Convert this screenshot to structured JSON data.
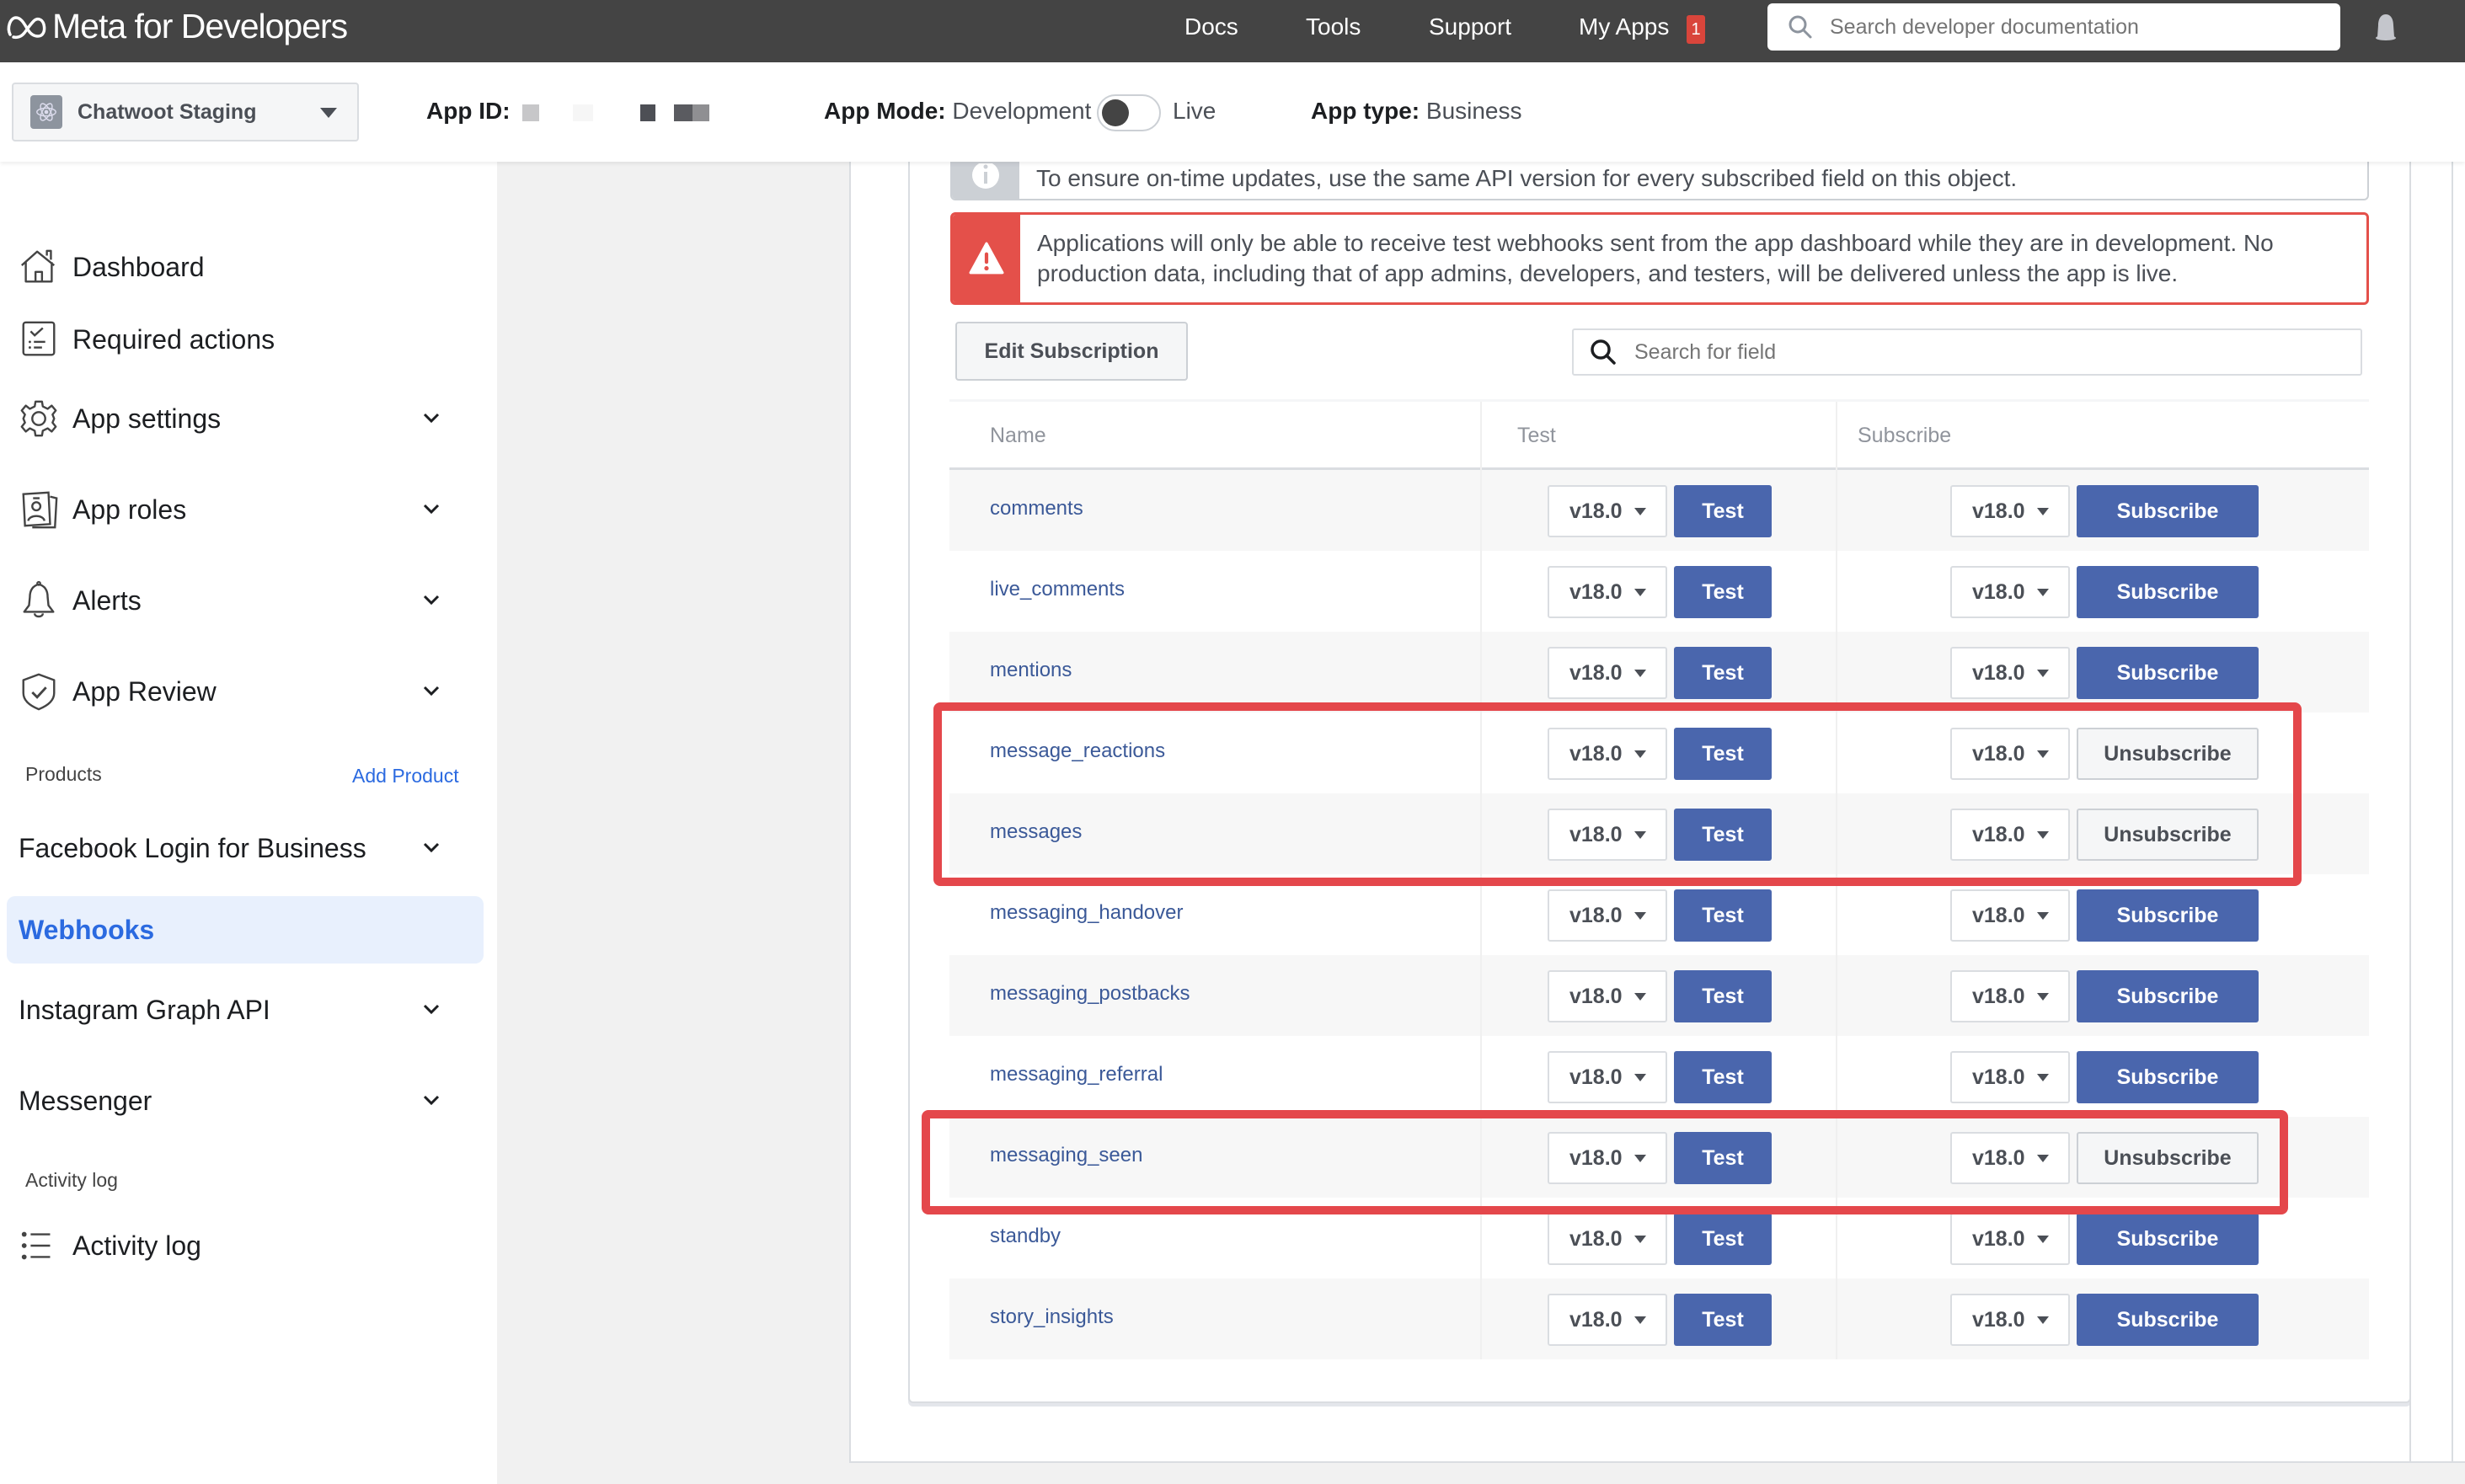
{
  "header": {
    "logo_text": "Meta for Developers",
    "nav": [
      "Docs",
      "Tools",
      "Support",
      "My Apps"
    ],
    "my_apps_badge": "1",
    "search_placeholder": "Search developer documentation"
  },
  "subheader": {
    "app_name": "Chatwoot Staging",
    "app_id_label": "App ID:",
    "app_mode_label": "App Mode:",
    "app_mode_value": "Development",
    "live_label": "Live",
    "app_type_label": "App type:",
    "app_type_value": "Business",
    "live_enabled": false
  },
  "sidebar": {
    "items": [
      {
        "label": "Dashboard",
        "icon": "home-icon"
      },
      {
        "label": "Required actions",
        "icon": "checklist-icon"
      },
      {
        "label": "App settings",
        "icon": "gear-icon",
        "expandable": true
      },
      {
        "label": "App roles",
        "icon": "id-badge-icon",
        "expandable": true
      },
      {
        "label": "Alerts",
        "icon": "bell-icon",
        "expandable": true
      },
      {
        "label": "App Review",
        "icon": "shield-check-icon",
        "expandable": true
      }
    ],
    "products_label": "Products",
    "add_product_label": "Add Product",
    "products": [
      {
        "label": "Facebook Login for Business",
        "expandable": true
      },
      {
        "label": "Webhooks",
        "active": true
      },
      {
        "label": "Instagram Graph API",
        "expandable": true
      },
      {
        "label": "Messenger",
        "expandable": true
      }
    ],
    "activity_section_label": "Activity log",
    "activity_item_label": "Activity log"
  },
  "notices": {
    "info": "To ensure on-time updates, use the same API version for every subscribed field on this object.",
    "warning": "Applications will only be able to receive test webhooks sent from the app dashboard while they are in development. No production data, including that of app admins, developers, and testers, will be delivered unless the app is live."
  },
  "toolbar": {
    "edit_subscription_label": "Edit Subscription",
    "search_field_placeholder": "Search for field"
  },
  "table": {
    "columns": [
      "Name",
      "Test",
      "Subscribe"
    ],
    "rows": [
      {
        "name": "comments",
        "test_version": "v18.0",
        "test_label": "Test",
        "sub_version": "v18.0",
        "action": "Subscribe",
        "subscribed": false
      },
      {
        "name": "live_comments",
        "test_version": "v18.0",
        "test_label": "Test",
        "sub_version": "v18.0",
        "action": "Subscribe",
        "subscribed": false
      },
      {
        "name": "mentions",
        "test_version": "v18.0",
        "test_label": "Test",
        "sub_version": "v18.0",
        "action": "Subscribe",
        "subscribed": false
      },
      {
        "name": "message_reactions",
        "test_version": "v18.0",
        "test_label": "Test",
        "sub_version": "v18.0",
        "action": "Unsubscribe",
        "subscribed": true
      },
      {
        "name": "messages",
        "test_version": "v18.0",
        "test_label": "Test",
        "sub_version": "v18.0",
        "action": "Unsubscribe",
        "subscribed": true
      },
      {
        "name": "messaging_handover",
        "test_version": "v18.0",
        "test_label": "Test",
        "sub_version": "v18.0",
        "action": "Subscribe",
        "subscribed": false
      },
      {
        "name": "messaging_postbacks",
        "test_version": "v18.0",
        "test_label": "Test",
        "sub_version": "v18.0",
        "action": "Subscribe",
        "subscribed": false
      },
      {
        "name": "messaging_referral",
        "test_version": "v18.0",
        "test_label": "Test",
        "sub_version": "v18.0",
        "action": "Subscribe",
        "subscribed": false
      },
      {
        "name": "messaging_seen",
        "test_version": "v18.0",
        "test_label": "Test",
        "sub_version": "v18.0",
        "action": "Unsubscribe",
        "subscribed": true
      },
      {
        "name": "standby",
        "test_version": "v18.0",
        "test_label": "Test",
        "sub_version": "v18.0",
        "action": "Subscribe",
        "subscribed": false
      },
      {
        "name": "story_insights",
        "test_version": "v18.0",
        "test_label": "Test",
        "sub_version": "v18.0",
        "action": "Subscribe",
        "subscribed": false
      }
    ]
  },
  "colors": {
    "header_bg": "#444444",
    "primary_button": "#4a66ad",
    "field_link": "#3b5998",
    "warning_red": "#e4504a",
    "highlight_red": "#e4474b",
    "active_nav": "#2b6ae0"
  }
}
